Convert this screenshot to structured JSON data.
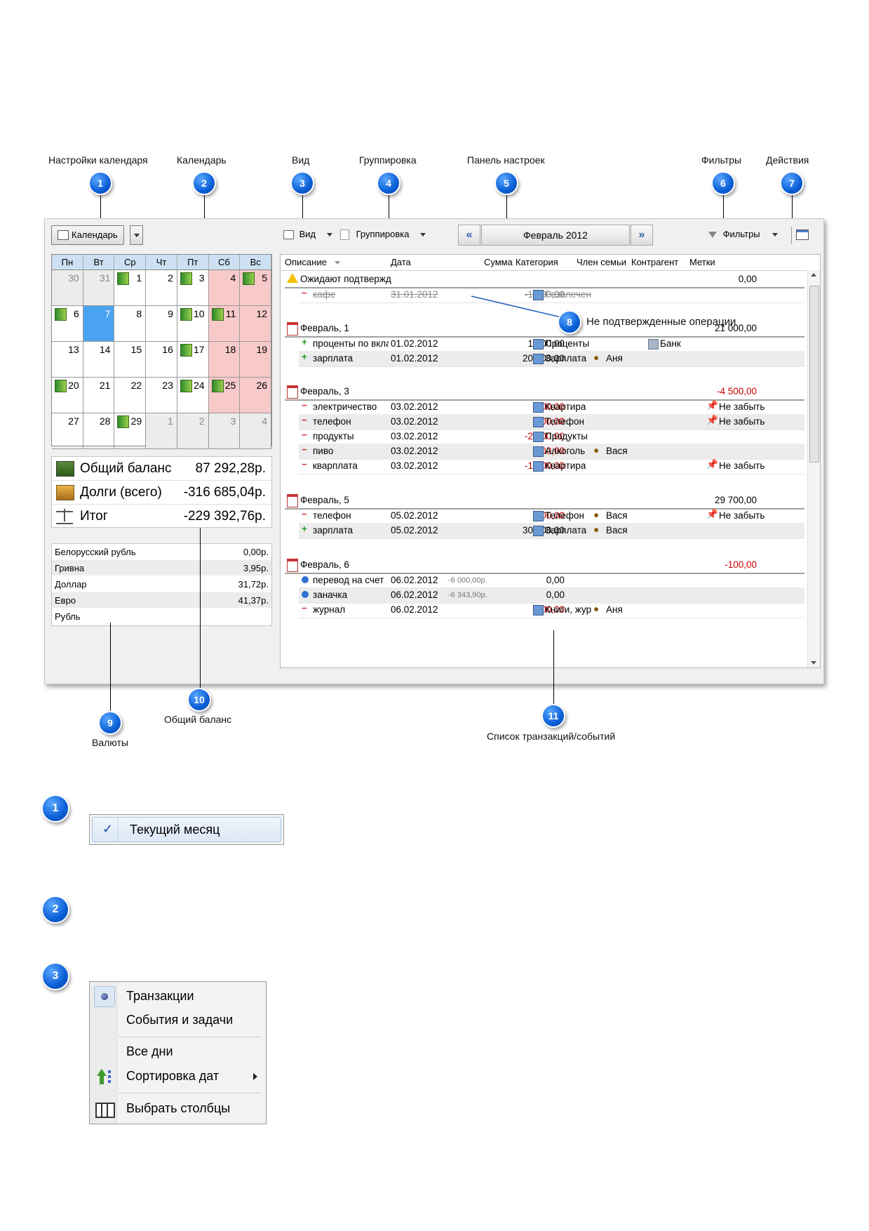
{
  "callouts": {
    "c1": {
      "num": "1",
      "label": "Настройки календаря"
    },
    "c2": {
      "num": "2",
      "label": "Календарь"
    },
    "c3": {
      "num": "3",
      "label": "Вид"
    },
    "c4": {
      "num": "4",
      "label": "Группировка"
    },
    "c5": {
      "num": "5",
      "label": "Панель настроек"
    },
    "c6": {
      "num": "6",
      "label": "Фильтры"
    },
    "c7": {
      "num": "7",
      "label": "Действия"
    },
    "c8": {
      "num": "8",
      "label": "Не подтвержденные операции"
    },
    "c9": {
      "num": "9",
      "label": "Валюты"
    },
    "c10": {
      "num": "10",
      "label": "Общий баланс"
    },
    "c11": {
      "num": "11",
      "label": "Список транзакций/событий"
    }
  },
  "toolbar": {
    "calendar_label": "Календарь",
    "view_label": "Вид",
    "grouping_label": "Группировка",
    "month": "Февраль 2012",
    "prev": "«",
    "next": "»",
    "filters_label": "Фильтры"
  },
  "calendar": {
    "weekdays": [
      "Пн",
      "Вт",
      "Ср",
      "Чт",
      "Пт",
      "Сб",
      "Вс"
    ],
    "weeks": [
      [
        {
          "d": "30",
          "t": "other"
        },
        {
          "d": "31",
          "t": "other"
        },
        {
          "d": "1",
          "m": true
        },
        {
          "d": "2"
        },
        {
          "d": "3",
          "m": true
        },
        {
          "d": "4",
          "t": "weekend"
        },
        {
          "d": "5",
          "t": "weekend",
          "m": true
        }
      ],
      [
        {
          "d": "6",
          "m": true
        },
        {
          "d": "7",
          "t": "today"
        },
        {
          "d": "8"
        },
        {
          "d": "9"
        },
        {
          "d": "10",
          "m": true
        },
        {
          "d": "11",
          "t": "weekend",
          "m": true
        },
        {
          "d": "12",
          "t": "weekend"
        }
      ],
      [
        {
          "d": "13"
        },
        {
          "d": "14"
        },
        {
          "d": "15"
        },
        {
          "d": "16"
        },
        {
          "d": "17",
          "m": true
        },
        {
          "d": "18",
          "t": "weekend"
        },
        {
          "d": "19",
          "t": "weekend"
        }
      ],
      [
        {
          "d": "20",
          "m": true
        },
        {
          "d": "21"
        },
        {
          "d": "22"
        },
        {
          "d": "23"
        },
        {
          "d": "24",
          "m": true
        },
        {
          "d": "25",
          "t": "weekend",
          "m": true
        },
        {
          "d": "26",
          "t": "weekend"
        }
      ],
      [
        {
          "d": "27"
        },
        {
          "d": "28"
        },
        {
          "d": "29",
          "m": true
        },
        {
          "d": "1",
          "t": "other"
        },
        {
          "d": "2",
          "t": "other"
        },
        {
          "d": "3",
          "t": "other"
        },
        {
          "d": "4",
          "t": "other"
        }
      ]
    ]
  },
  "balance": {
    "total_label": "Общий баланс",
    "total_value": "87 292,28р.",
    "debts_label": "Долги (всего)",
    "debts_value": "-316 685,04р.",
    "result_label": "Итог",
    "result_value": "-229 392,76р."
  },
  "currencies": [
    {
      "name": "Белорусский рубль",
      "value": "0,00р."
    },
    {
      "name": "Гривна",
      "value": "3,95р."
    },
    {
      "name": "Доллар",
      "value": "31,72р."
    },
    {
      "name": "Евро",
      "value": "41,37р."
    },
    {
      "name": "Рубль",
      "value": ""
    }
  ],
  "columns": [
    "Описание",
    "Дата",
    "Сумма",
    "Категория",
    "Член семьи",
    "Контрагент",
    "Метки"
  ],
  "pending": {
    "title": "Ожидают подтвержд",
    "sum": "0,00",
    "row": {
      "desc": "кафе",
      "date": "31.01.2012",
      "sum": "-1 000,00",
      "cat": "Развлечен"
    }
  },
  "groups": [
    {
      "title": "Февраль, 1",
      "sum": "21 000,00",
      "rows": [
        {
          "sign": "+",
          "desc": "проценты по вкла",
          "date": "01.02.2012",
          "sum": "1 000,00",
          "cat": "Проценты",
          "member": "",
          "contr": "Банк",
          "tag": ""
        },
        {
          "sign": "+",
          "desc": "зарплата",
          "date": "01.02.2012",
          "sum": "20 000,00",
          "cat": "Зарплата",
          "member": "Аня",
          "contr": "",
          "tag": ""
        }
      ]
    },
    {
      "title": "Февраль, 3",
      "sum": "-4 500,00",
      "rows": [
        {
          "sign": "-",
          "desc": "электричество",
          "date": "03.02.2012",
          "sum": "-500,00",
          "cat": "Квартира",
          "member": "",
          "contr": "",
          "tag": "Не забыть"
        },
        {
          "sign": "-",
          "desc": "телефон",
          "date": "03.02.2012",
          "sum": "-300,00",
          "cat": "Телефон",
          "member": "",
          "contr": "",
          "tag": "Не забыть"
        },
        {
          "sign": "-",
          "desc": "продукты",
          "date": "03.02.2012",
          "sum": "-2 000,00",
          "cat": "Продукты",
          "member": "",
          "contr": "",
          "tag": ""
        },
        {
          "sign": "-",
          "desc": "пиво",
          "date": "03.02.2012",
          "sum": "-200,00",
          "cat": "Алкоголь",
          "member": "Вася",
          "contr": "",
          "tag": ""
        },
        {
          "sign": "-",
          "desc": "кварплата",
          "date": "03.02.2012",
          "sum": "-1 500,00",
          "cat": "Квартира",
          "member": "",
          "contr": "",
          "tag": "Не забыть"
        }
      ]
    },
    {
      "title": "Февраль, 5",
      "sum": "29 700,00",
      "rows": [
        {
          "sign": "-",
          "desc": "телефон",
          "date": "05.02.2012",
          "sum": "-300,00",
          "cat": "Телефон",
          "member": "Вася",
          "contr": "",
          "tag": "Не забыть"
        },
        {
          "sign": "+",
          "desc": "зарплата",
          "date": "05.02.2012",
          "sum": "30 000,00",
          "cat": "Зарплата",
          "member": "Вася",
          "contr": "",
          "tag": ""
        }
      ]
    },
    {
      "title": "Февраль, 6",
      "sum": "-100,00",
      "rows": [
        {
          "sign": "t",
          "desc": "перевод на счет",
          "date": "06.02.2012",
          "pre": "-6 000,00р.",
          "sum": "0,00",
          "cat": "",
          "member": "",
          "contr": "",
          "tag": ""
        },
        {
          "sign": "t",
          "desc": "заначка",
          "date": "06.02.2012",
          "pre": "-6 343,90р.",
          "sum": "0,00",
          "cat": "",
          "member": "",
          "contr": "",
          "tag": ""
        },
        {
          "sign": "-",
          "desc": "журнал",
          "date": "06.02.2012",
          "sum": "-100,00",
          "cat": "Книги, жур",
          "member": "Аня",
          "contr": "",
          "tag": ""
        }
      ]
    }
  ],
  "menu1": {
    "item": "Текущий месяц",
    "check": "✓"
  },
  "menu3": {
    "items": [
      "Транзакции",
      "События и задачи",
      "Все дни",
      "Сортировка дат",
      "Выбрать столбцы"
    ]
  },
  "section_numbers": [
    "1",
    "2",
    "3"
  ],
  "colors": {
    "accent": "#0b5fd6",
    "today": "#4aa3f0",
    "weekend": "#f7c9c9",
    "negative": "#cc0000",
    "header": "#cde0f3"
  }
}
